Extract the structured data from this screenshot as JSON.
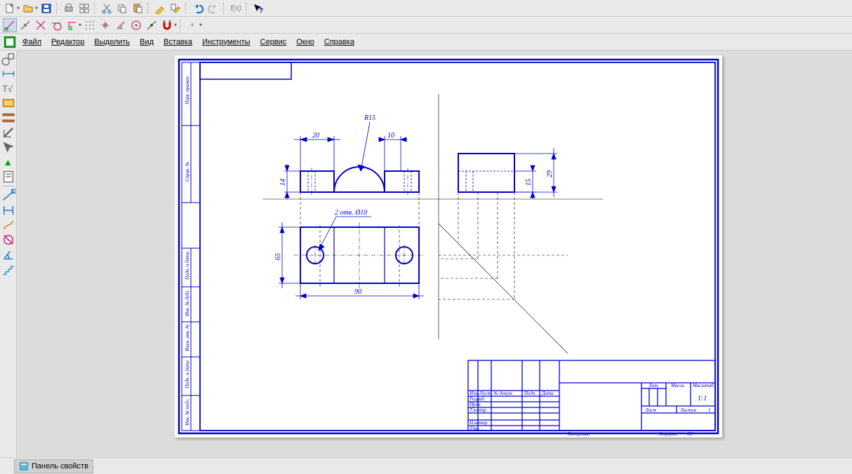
{
  "menu": {
    "file": "Файл",
    "editor": "Редактор",
    "select": "Выделить",
    "view": "Вид",
    "insert": "Вставка",
    "tools": "Инструменты",
    "service": "Сервис",
    "window": "Окно",
    "help": "Справка"
  },
  "drawing": {
    "dims": {
      "r15": "R15",
      "d20": "20",
      "d10": "10",
      "d14": "14",
      "d15": "15",
      "d29": "29",
      "d90": "90",
      "d65": "65",
      "holes": "2 отв. Ø10"
    },
    "titleblock": {
      "izm": "Изм.",
      "list": "Лист",
      "ndokum": "№ докум.",
      "podp": "Подп.",
      "data": "Дата",
      "razrab": "Разраб.",
      "prov": "Пров.",
      "tkontr": "Т.контр.",
      "nkontr": "Н.контр.",
      "utv": "Утв.",
      "lit": "Лит.",
      "massa": "Масса",
      "masshtab": "Масштаб",
      "scale": "1:1",
      "list2": "Лист",
      "listov": "Листов",
      "listov_n": "1",
      "kopiroval": "Копировал",
      "format": "Формат",
      "fmt": "A3"
    },
    "sidecols": {
      "c1": "Перв. примен.",
      "c2": "Справ. №",
      "c3": "Подп. и дата",
      "c4": "Инв. № дубл.",
      "c5": "Взам. инв. №",
      "c6": "Подп. и дата",
      "c7": "Инв. № подл."
    }
  },
  "bottom": {
    "panel": "Панель свойств"
  }
}
